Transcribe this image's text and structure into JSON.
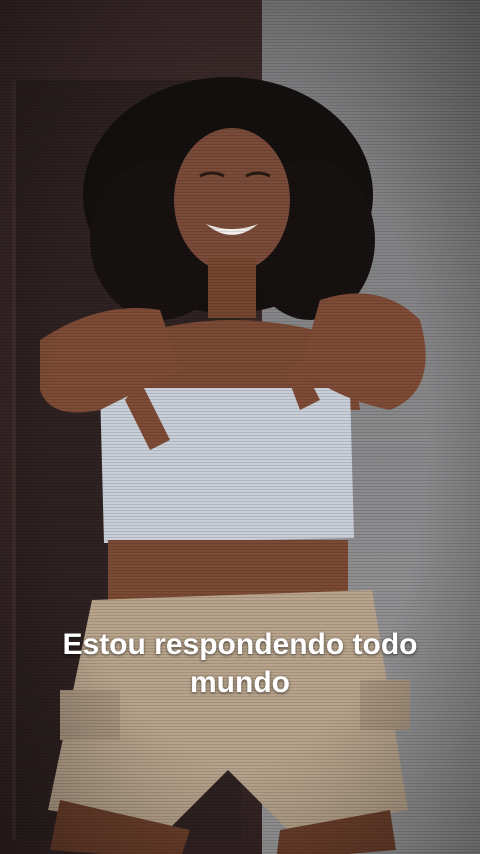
{
  "caption": {
    "text": "Estou  respondendo todo\nmundo",
    "color": "#ffffff"
  },
  "scene": {
    "description_icon": "video-frame"
  }
}
